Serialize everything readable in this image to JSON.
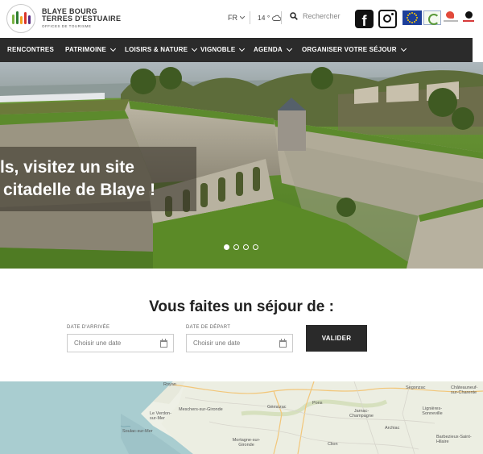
{
  "header": {
    "logo": {
      "line1": "BLAYE BOURG",
      "line2": "TERRES D'ESTUAIRE",
      "line3": "OFFICES DE TOURISME",
      "bar_colors": [
        "#7bb342",
        "#2e7d32",
        "#f4a11d",
        "#d9342b",
        "#5a2d82"
      ]
    },
    "language": "FR",
    "weather": "14 °",
    "search_placeholder": "Rechercher",
    "facebook_letter": "f"
  },
  "nav": {
    "items": [
      {
        "label": "RENCONTRES",
        "has_dropdown": false
      },
      {
        "label": "PATRIMOINE",
        "has_dropdown": true
      },
      {
        "label": "LOISIRS & NATURE",
        "has_dropdown": true
      },
      {
        "label": "VIGNOBLE",
        "has_dropdown": true
      },
      {
        "label": "AGENDA",
        "has_dropdown": true
      },
      {
        "label": "ORGANISER VOTRE SÉJOUR",
        "has_dropdown": true
      }
    ]
  },
  "hero": {
    "caption_line1": "ls, visitez un site",
    "caption_line2": "citadelle de Blaye !",
    "slides_total": 4,
    "active_slide": 1
  },
  "booking": {
    "title": "Vous faites un séjour de :",
    "arrival_label": "DATE D'ARRIVÉE",
    "arrival_placeholder": "Choisir une date",
    "departure_label": "DATE DE DÉPART",
    "departure_placeholder": "Choisir une date",
    "submit_label": "VALIDER"
  },
  "map": {
    "places": [
      "Royan",
      "Meschers-sur-Gironde",
      "Gémozac",
      "Pons",
      "Jarnac-Champagne",
      "Segonzac",
      "Châteauneuf-sur-Charente",
      "Lignières-Sonneville",
      "Le Verdon-sur-Mer",
      "Soulac-sur-Mer",
      "Mortagne-sur-Gironde",
      "Clion",
      "Archiac",
      "Barbezieux-Saint-Hilaire"
    ]
  }
}
